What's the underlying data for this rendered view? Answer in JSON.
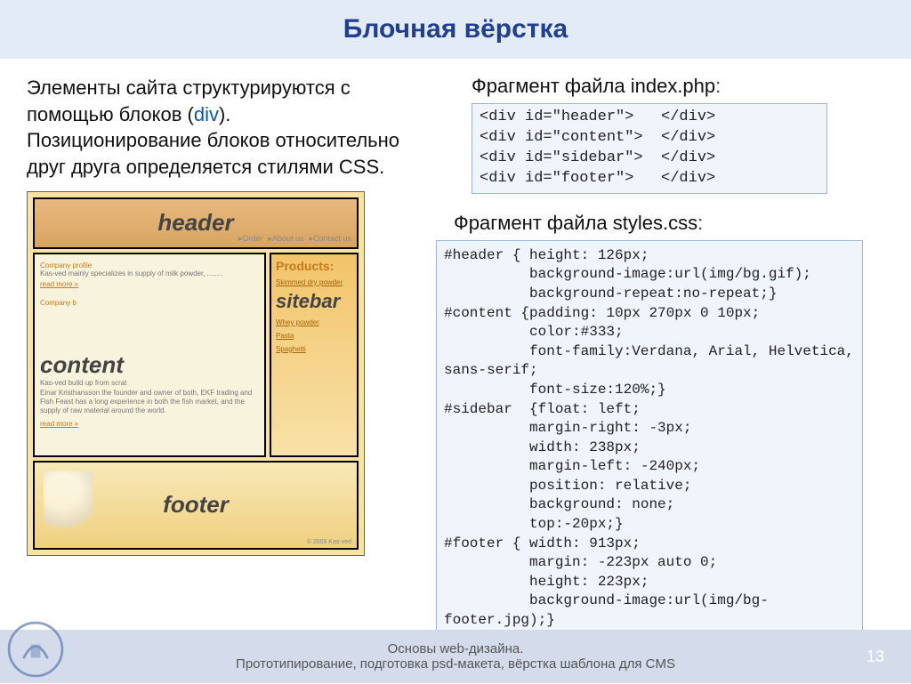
{
  "title": "Блочная вёрстка",
  "intro": {
    "prefix": "Элементы сайта структурируются с помощью блоков (",
    "keyword": "div",
    "suffix": "). Позиционирование блоков относительно друг друга определяется стилями CSS."
  },
  "mockup": {
    "header_label": "header",
    "nav": [
      "▸Order",
      "▸About us",
      "▸Contact us"
    ],
    "content_label": "content",
    "content_heading1": "Company profile",
    "content_text1": "Kas-ved mainly specializes in supply of milk powder, ........",
    "content_readmore": "read more »",
    "content_heading2": "Company b",
    "content_text2a": "Kas-ved build up from scrat",
    "content_text2b": "Einar Kristhansson the founder and owner of both, EKF trading and Fish Feast has a long experience in both the fish market, and the supply of raw material around the world.",
    "sidebar_label": "sitebar",
    "sidebar_heading": "Products:",
    "sidebar_items": [
      "Skimmed dry powder",
      "Whey powder",
      "Pasta",
      "Spaghetti"
    ],
    "footer_label": "footer",
    "footer_copy": "© 2009 Kas-ved"
  },
  "snippet1": {
    "title_prefix": "Фрагмент файла index.php",
    "colon": ":",
    "code": "<div id=\"header\">   </div>\n<div id=\"content\">  </div>\n<div id=\"sidebar\">  </div>\n<div id=\"footer\">   </div>"
  },
  "snippet2": {
    "title_prefix": "Фрагмент файла styles.css",
    "colon": ":",
    "code": "#header { height: 126px;\n          background-image:url(img/bg.gif);\n          background-repeat:no-repeat;}\n#content {padding: 10px 270px 0 10px;\n          color:#333;\n          font-family:Verdana, Arial, Helvetica, sans-serif;\n          font-size:120%;}\n#sidebar  {float: left;\n          margin-right: -3px;\n          width: 238px;\n          margin-left: -240px;\n          position: relative;\n          background: none;\n          top:-20px;}\n#footer { width: 913px;\n          margin: -223px auto 0;\n          height: 223px;\n          background-image:url(img/bg-footer.jpg);}"
  },
  "footer": {
    "line1": "Основы web-дизайна.",
    "line2": "Прототипирование, подготовка psd-макета, вёрстка шаблона для CMS",
    "page": "13"
  }
}
